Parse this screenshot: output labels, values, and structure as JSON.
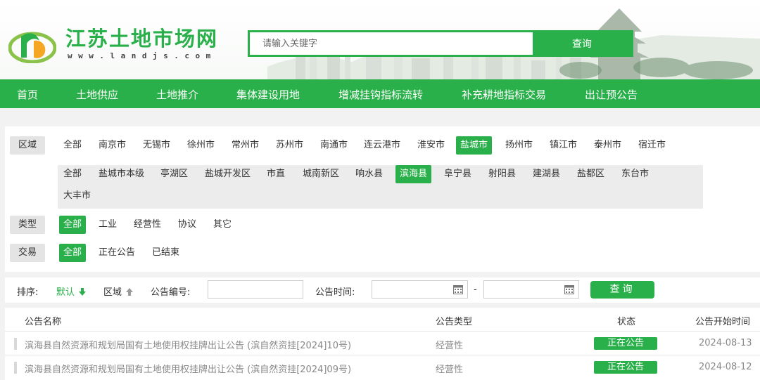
{
  "header": {
    "site_title": "江苏土地市场网",
    "site_url": "www.landjs.com",
    "search_placeholder": "请输入关键字",
    "search_button": "查询"
  },
  "nav": [
    "首页",
    "土地供应",
    "土地推介",
    "集体建设用地",
    "增减挂钩指标流转",
    "补充耕地指标交易",
    "出让预公告"
  ],
  "filters": {
    "region_label": "区域",
    "regions": [
      "全部",
      "南京市",
      "无锡市",
      "徐州市",
      "常州市",
      "苏州市",
      "南通市",
      "连云港市",
      "淮安市",
      "盐城市",
      "扬州市",
      "镇江市",
      "泰州市",
      "宿迁市"
    ],
    "region_selected": "盐城市",
    "sub_regions": [
      "全部",
      "盐城市本级",
      "亭湖区",
      "盐城开发区",
      "市直",
      "城南新区",
      "响水县",
      "滨海县",
      "阜宁县",
      "射阳县",
      "建湖县",
      "盐都区",
      "东台市",
      "大丰市"
    ],
    "sub_region_selected": "滨海县",
    "type_label": "类型",
    "types": [
      "全部",
      "工业",
      "经营性",
      "协议",
      "其它"
    ],
    "type_selected": "全部",
    "trade_label": "交易",
    "trades": [
      "全部",
      "正在公告",
      "已结束"
    ],
    "trade_selected": "全部"
  },
  "sort_bar": {
    "sort_label": "排序:",
    "default_label": "默认",
    "region_label": "区域",
    "notice_no_label": "公告编号:",
    "notice_time_label": "公告时间:",
    "date_separator": "-",
    "query_button": "查询"
  },
  "table": {
    "headers": [
      "公告名称",
      "公告类型",
      "状态",
      "公告开始时间"
    ],
    "rows": [
      {
        "name": "滨海县自然资源和规划局国有土地使用权挂牌出让公告 (滨自然资挂[2024]10号)",
        "type": "经营性",
        "status": "正在公告",
        "date": "2024-08-13"
      },
      {
        "name": "滨海县自然资源和规划局国有土地使用权挂牌出让公告 (滨自然资挂[2024]09号)",
        "type": "经营性",
        "status": "正在公告",
        "date": "2024-08-12"
      }
    ]
  },
  "colors": {
    "brand": "#2ab04a",
    "label_bg": "#e4e4e4",
    "panel_bg": "#ffffff",
    "page_bg": "#f2f2f2"
  },
  "icons": [
    "landjs-logo-icon",
    "calendar-icon",
    "arrow-down-icon",
    "arrow-up-icon"
  ]
}
